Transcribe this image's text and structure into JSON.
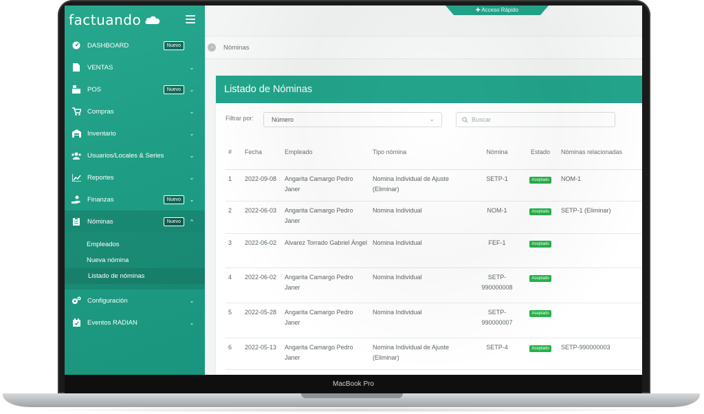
{
  "device": {
    "model_label": "MacBook Pro"
  },
  "brand": {
    "name": "factuando"
  },
  "topbar": {
    "quick_access_label": "✚ Acceso Rápido"
  },
  "breadcrumb": {
    "current": "Nóminas"
  },
  "sidebar": {
    "items": [
      {
        "label": "DASHBOARD",
        "icon": "dashboard-icon",
        "badge": "Nuevo",
        "chevron": ""
      },
      {
        "label": "VENTAS",
        "icon": "file-icon",
        "badge": "",
        "chevron": "⌄"
      },
      {
        "label": "POS",
        "icon": "cash-register-icon",
        "badge": "Nuevo",
        "chevron": "⌄"
      },
      {
        "label": "Compras",
        "icon": "cart-icon",
        "badge": "",
        "chevron": "⌄"
      },
      {
        "label": "Inventario",
        "icon": "warehouse-icon",
        "badge": "",
        "chevron": "⌄"
      },
      {
        "label": "Usuarios/Locales & Series",
        "icon": "users-icon",
        "badge": "",
        "chevron": "⌄"
      },
      {
        "label": "Reportes",
        "icon": "chart-icon",
        "badge": "",
        "chevron": "⌄"
      },
      {
        "label": "Finanzas",
        "icon": "money-hand-icon",
        "badge": "Nuevo",
        "chevron": "⌄"
      },
      {
        "label": "Nóminas",
        "icon": "clipboard-icon",
        "badge": "Nuevo",
        "chevron": "^"
      }
    ],
    "submenu": [
      {
        "label": "Empleados"
      },
      {
        "label": "Nueva nómina"
      },
      {
        "label": "Listado de nóminas"
      }
    ],
    "items_after": [
      {
        "label": "Configuración",
        "icon": "gears-icon",
        "chevron": "⌄"
      },
      {
        "label": "Eventos RADIAN",
        "icon": "calendar-check-icon",
        "chevron": "⌄"
      }
    ]
  },
  "card": {
    "title": "Listado de Nóminas"
  },
  "filters": {
    "label": "Filtrar por:",
    "select_value": "Número",
    "search_placeholder": "Buscar"
  },
  "table": {
    "headers": [
      "#",
      "Fecha",
      "Empleado",
      "Tipo nómina",
      "Nómina",
      "Estado",
      "Nóminas relacionadas"
    ],
    "rows": [
      {
        "num": "1",
        "date": "2022-09-08",
        "employee": "Angarita Camargo Pedro Janer",
        "type": "Nomina Individual de Ajuste (Eliminar)",
        "nomina": "SETP-1",
        "status": "Aceptado",
        "related": "NOM-1"
      },
      {
        "num": "2",
        "date": "2022-06-03",
        "employee": "Angarita Camargo Pedro Janer",
        "type": "Nomina Individual",
        "nomina": "NOM-1",
        "status": "Aceptado",
        "related": "SETP-1 (Eliminar)"
      },
      {
        "num": "3",
        "date": "2022-06-02",
        "employee": "Alvarez Torrado Gabriel Ángel",
        "type": "Nomina Individual",
        "nomina": "FEF-1",
        "status": "Aceptado",
        "related": ""
      },
      {
        "num": "4",
        "date": "2022-06-02",
        "employee": "Angarita Camargo Pedro Janer",
        "type": "Nomina Individual",
        "nomina": "SETP-990000008",
        "status": "Aceptado",
        "related": ""
      },
      {
        "num": "5",
        "date": "2022-05-28",
        "employee": "Angarita Camargo Pedro Janer",
        "type": "Nomina Individual",
        "nomina": "SETP-990000007",
        "status": "Aceptado",
        "related": ""
      },
      {
        "num": "6",
        "date": "2022-05-13",
        "employee": "Angarita Camargo Pedro Janer",
        "type": "Nomina Individual de Ajuste (Eliminar)",
        "nomina": "SETP-4",
        "status": "Aceptado",
        "related": "SETP-990000003"
      }
    ]
  },
  "colors": {
    "brand": "#23a58b",
    "sidebar": "#1e9d84",
    "status_ok": "#26b24a"
  }
}
